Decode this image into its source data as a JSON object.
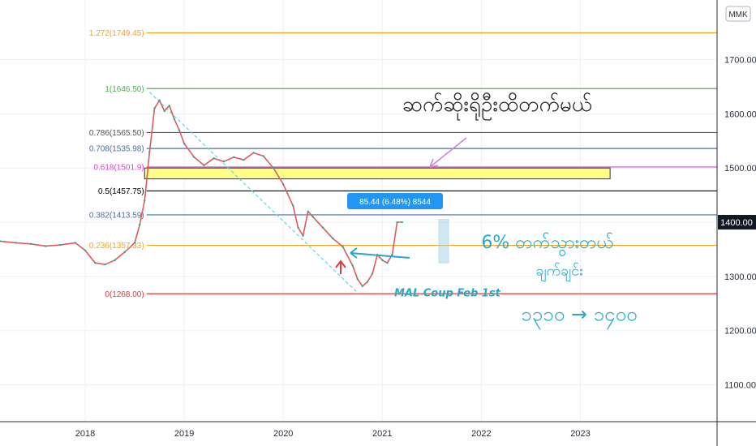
{
  "chart_data": {
    "type": "line",
    "title": "",
    "currency_badge": "MMK",
    "xlabel": "",
    "ylabel": "",
    "xlim": [
      2017.14,
      2024.38
    ],
    "ylim": [
      1032,
      1810
    ],
    "grid": true,
    "x_ticks": [
      {
        "value": 2018,
        "label": "2018"
      },
      {
        "value": 2019,
        "label": "2019"
      },
      {
        "value": 2020,
        "label": "2020"
      },
      {
        "value": 2021,
        "label": "2021"
      },
      {
        "value": 2022,
        "label": "2022"
      },
      {
        "value": 2023,
        "label": "2023"
      }
    ],
    "y_ticks": [
      {
        "value": 1100,
        "label": "1100.00"
      },
      {
        "value": 1200,
        "label": "1200.00"
      },
      {
        "value": 1300,
        "label": "1300.00"
      },
      {
        "value": 1400,
        "label": "1400.00"
      },
      {
        "value": 1500,
        "label": "1500.00"
      },
      {
        "value": 1600,
        "label": "1600.00"
      },
      {
        "value": 1700,
        "label": "1700.00"
      }
    ],
    "current_price": {
      "value": 1400,
      "label": "1400.00",
      "color": "#131722"
    },
    "fib_levels": [
      {
        "label": "1.272(1749.45)",
        "value": 1749.45,
        "color": "#f7a21b"
      },
      {
        "label": "1(1646.50)",
        "value": 1646.5,
        "color": "#4caf50"
      },
      {
        "label": "0.786(1565.50)",
        "value": 1565.5,
        "color": "#555555"
      },
      {
        "label": "0.708(1535.98)",
        "value": 1535.98,
        "color": "#4a6fa5"
      },
      {
        "label": "0.618(1501.9)",
        "value": 1501.9,
        "color": "#e040e0"
      },
      {
        "label": "0.5(1457.75)",
        "value": 1457.75,
        "color": "#000000"
      },
      {
        "label": "0.382(1413.59)",
        "value": 1413.59,
        "color": "#4a6fa5"
      },
      {
        "label": "0.236(1357.33)",
        "value": 1357.33,
        "color": "#f7a21b"
      },
      {
        "label": "0(1268.00)",
        "value": 1268.0,
        "color": "#e53935"
      }
    ],
    "highlight_zone": {
      "x_start": 2018.6,
      "x_end": 2023.3,
      "y_low": 1480,
      "y_high": 1500,
      "color": "#ffff88"
    },
    "trend_line": {
      "x1": 2018.65,
      "y1": 1640,
      "x2": 2020.75,
      "y2": 1270,
      "color": "#56d6f0"
    },
    "series": [
      {
        "values": [
          [
            2017.14,
            1365
          ],
          [
            2017.3,
            1362
          ],
          [
            2017.45,
            1360
          ],
          [
            2017.6,
            1356
          ],
          [
            2017.75,
            1358
          ],
          [
            2017.9,
            1362
          ],
          [
            2018.0,
            1348
          ],
          [
            2018.1,
            1325
          ],
          [
            2018.2,
            1322
          ],
          [
            2018.3,
            1330
          ],
          [
            2018.4,
            1345
          ],
          [
            2018.5,
            1362
          ],
          [
            2018.55,
            1395
          ],
          [
            2018.6,
            1440
          ],
          [
            2018.65,
            1530
          ],
          [
            2018.7,
            1610
          ],
          [
            2018.75,
            1625
          ],
          [
            2018.8,
            1605
          ],
          [
            2018.85,
            1615
          ],
          [
            2018.9,
            1590
          ],
          [
            2018.95,
            1570
          ],
          [
            2019.0,
            1545
          ],
          [
            2019.1,
            1520
          ],
          [
            2019.2,
            1505
          ],
          [
            2019.3,
            1518
          ],
          [
            2019.4,
            1512
          ],
          [
            2019.5,
            1520
          ],
          [
            2019.6,
            1515
          ],
          [
            2019.7,
            1528
          ],
          [
            2019.8,
            1522
          ],
          [
            2019.9,
            1500
          ],
          [
            2020.0,
            1470
          ],
          [
            2020.1,
            1430
          ],
          [
            2020.15,
            1390
          ],
          [
            2020.2,
            1375
          ],
          [
            2020.25,
            1420
          ],
          [
            2020.3,
            1410
          ],
          [
            2020.4,
            1390
          ],
          [
            2020.5,
            1370
          ],
          [
            2020.6,
            1355
          ],
          [
            2020.7,
            1320
          ],
          [
            2020.75,
            1295
          ],
          [
            2020.8,
            1282
          ],
          [
            2020.85,
            1290
          ],
          [
            2020.9,
            1305
          ],
          [
            2020.95,
            1340
          ],
          [
            2021.0,
            1330
          ],
          [
            2021.05,
            1325
          ],
          [
            2021.1,
            1340
          ],
          [
            2021.15,
            1400
          ],
          [
            2021.2,
            1400
          ]
        ],
        "color": "#e05a5a"
      }
    ],
    "measure_tooltip": {
      "text": "85.44 (6.48%) 8544",
      "bg": "#2196f3",
      "fg": "#ffffff"
    },
    "measure_box": {
      "x": 2021.62,
      "y_low": 1325,
      "y_high": 1405,
      "color": "#9fd3e6"
    },
    "annotations": [
      {
        "text": "MAL Coup Feb 1st",
        "x": 2021.12,
        "y": 1263,
        "color": "#27a9c4"
      },
      {
        "text": "ဆက်ဆိုးရိုဦးထိတက်မယ်",
        "x": 2021.2,
        "y": 1605,
        "color": "#222222"
      },
      {
        "text": "6% တက်သွားတယ်",
        "x": 2022.0,
        "y": 1352,
        "color": "#27a9c4"
      },
      {
        "text": "ချက်ချင်း",
        "x": 2022.55,
        "y": 1302,
        "color": "#27a9c4"
      },
      {
        "text": "၁၃၁၀ → ၁၄၀၀",
        "x": 2022.4,
        "y": 1218,
        "color": "#27a9c4"
      }
    ]
  }
}
